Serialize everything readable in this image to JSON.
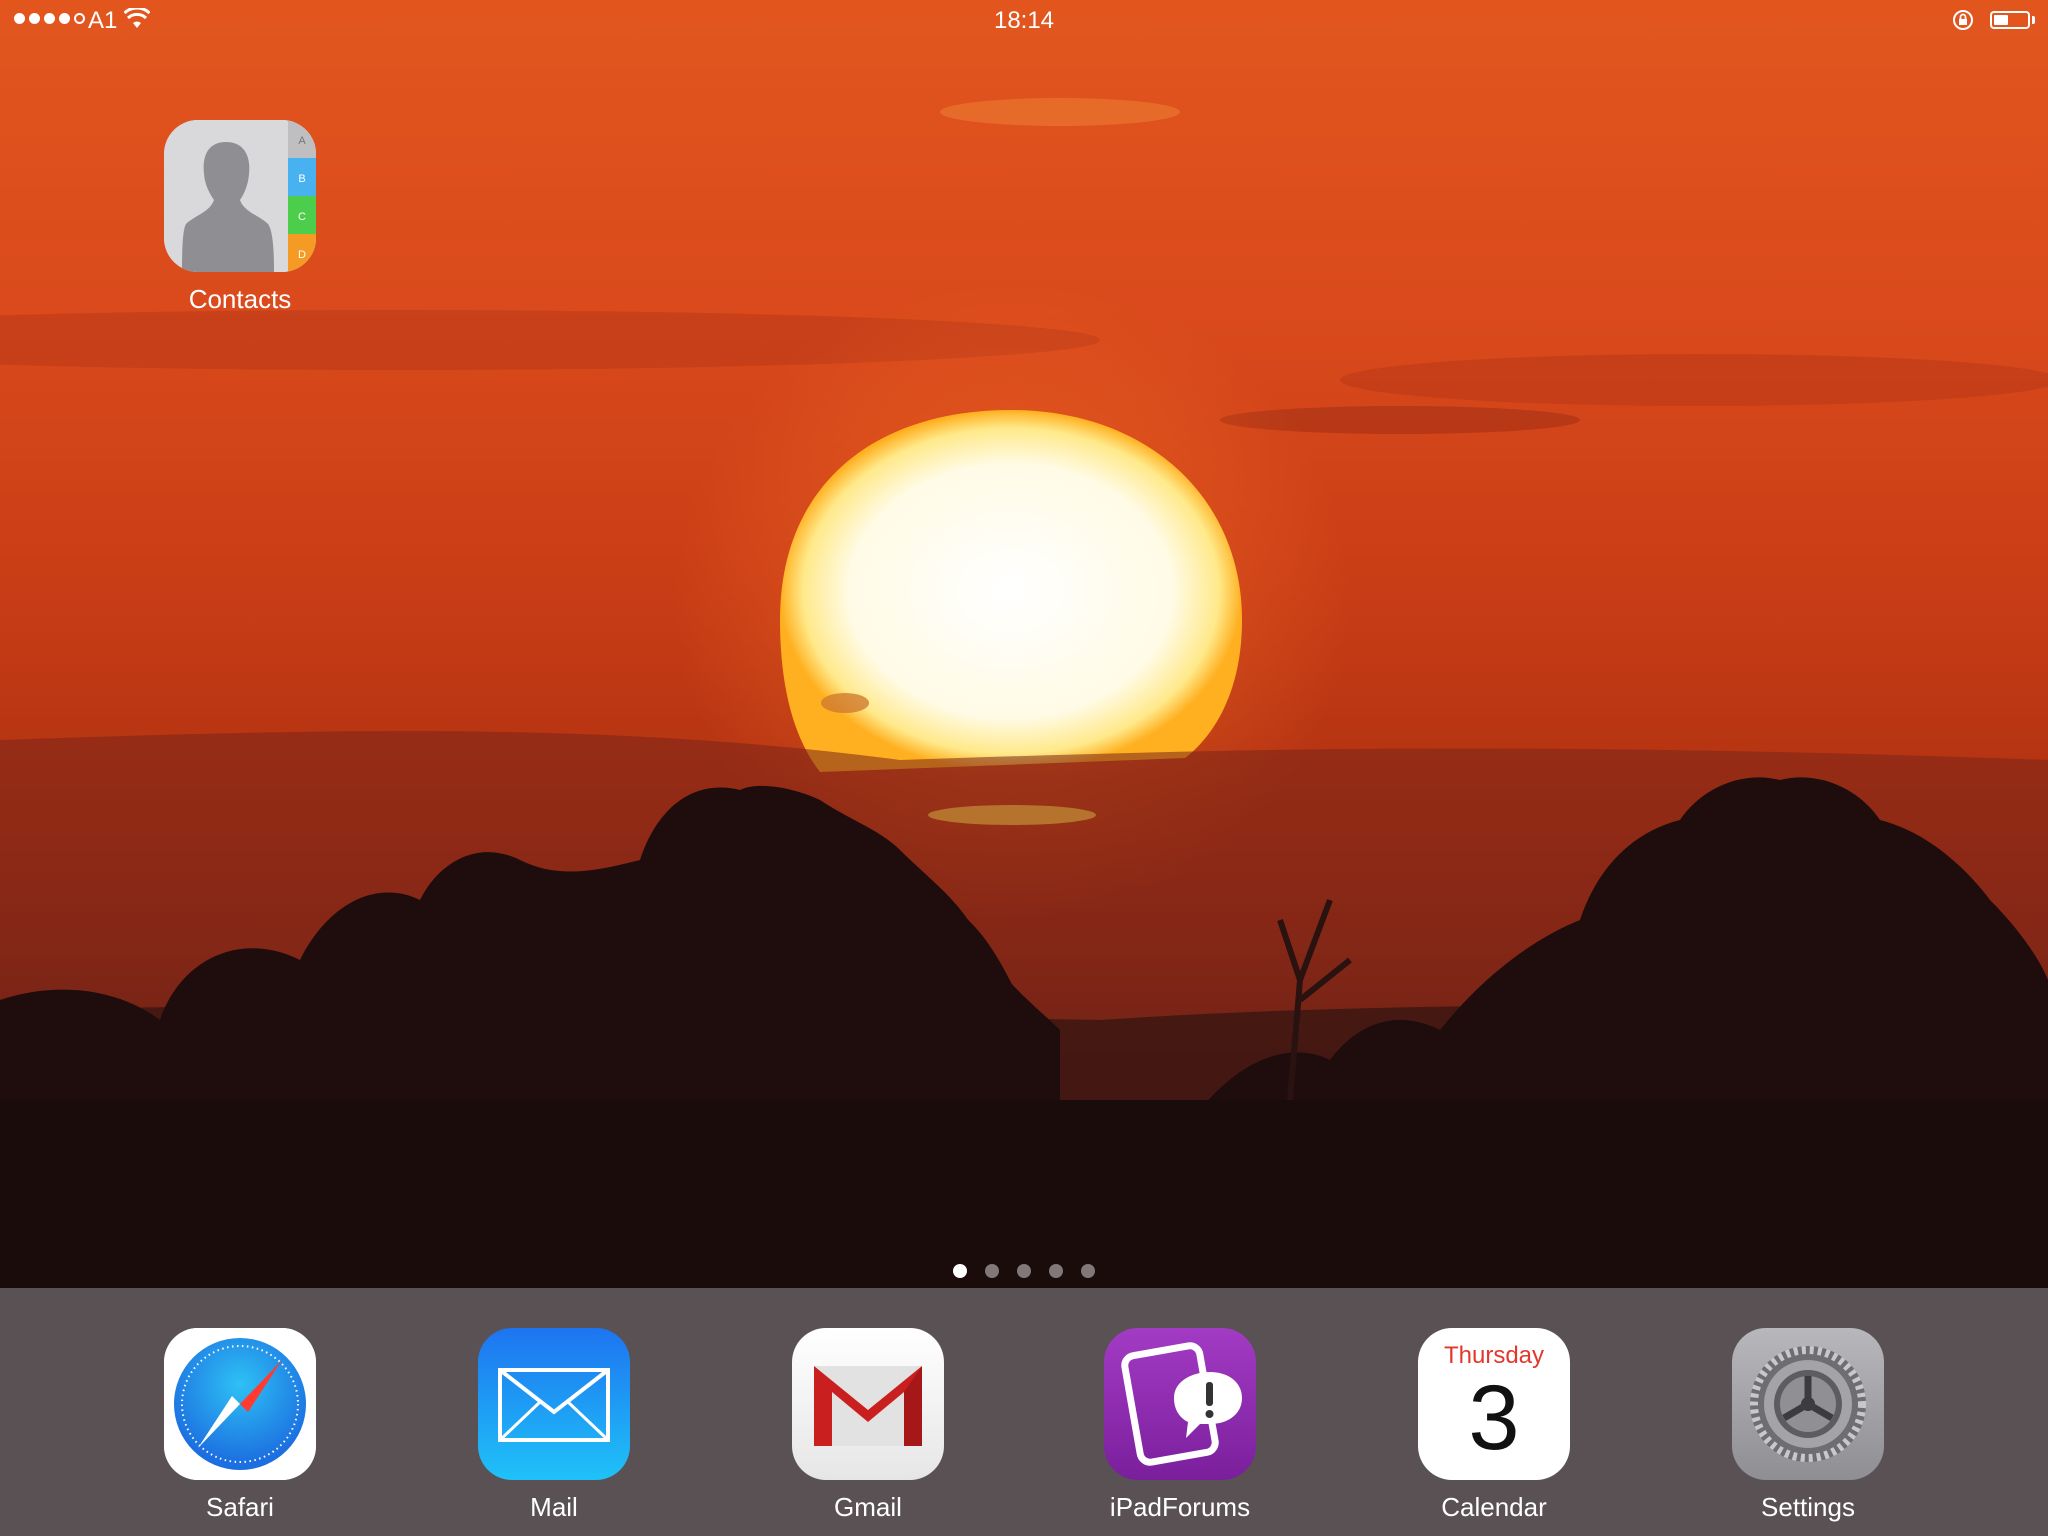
{
  "status_bar": {
    "carrier": "A1",
    "time": "18:14",
    "signal_bars": 4,
    "signal_total": 5,
    "battery_level": 0.45
  },
  "home": {
    "apps": [
      {
        "name": "Contacts",
        "icon": "contacts-icon"
      }
    ]
  },
  "page_indicator": {
    "pages": 5,
    "current": 1
  },
  "dock": {
    "apps": [
      {
        "name": "Safari",
        "icon": "safari-compass-icon"
      },
      {
        "name": "Mail",
        "icon": "mail-envelope-icon"
      },
      {
        "name": "Gmail",
        "icon": "gmail-icon"
      },
      {
        "name": "iPadForums",
        "icon": "ipadforums-icon"
      },
      {
        "name": "Calendar",
        "icon": "calendar-icon",
        "weekday": "Thursday",
        "day": "3"
      },
      {
        "name": "Settings",
        "icon": "settings-gear-icon"
      }
    ]
  },
  "colors": {
    "sky_top": "#e2561e",
    "sky_mid": "#c93d16",
    "sun": "#fff6d6",
    "tree_silhouette": "#1d0e0d",
    "dock": "#5f585c",
    "calendar_red": "#e2382c"
  }
}
